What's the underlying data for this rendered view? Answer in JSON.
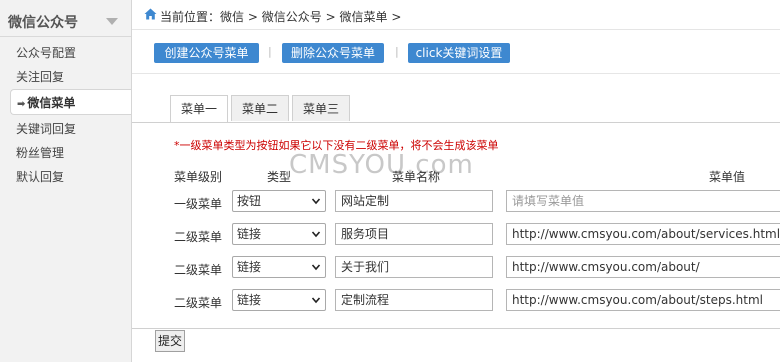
{
  "sidebar": {
    "title": "微信公众号",
    "items": [
      {
        "label": "公众号配置"
      },
      {
        "label": "关注回复"
      },
      {
        "label": "微信菜单"
      },
      {
        "label": "关键词回复"
      },
      {
        "label": "粉丝管理"
      },
      {
        "label": "默认回复"
      }
    ]
  },
  "breadcrumb": {
    "prefix": "当前位置：",
    "items": [
      "微信",
      "微信公众号",
      "微信菜单"
    ],
    "separator": ">"
  },
  "toolbar": {
    "buttons": [
      {
        "label": "创建公众号菜单"
      },
      {
        "label": "删除公众号菜单"
      },
      {
        "label": "click关键词设置"
      }
    ],
    "separator": "|"
  },
  "tabs": [
    {
      "label": "菜单一",
      "active": true
    },
    {
      "label": "菜单二",
      "active": false
    },
    {
      "label": "菜单三",
      "active": false
    }
  ],
  "notice": "*一级菜单类型为按钮如果它以下没有二级菜单，将不会生成该菜单",
  "watermark": "CMSYOU.com",
  "table": {
    "headers": {
      "level": "菜单级别",
      "type": "类型",
      "name": "菜单名称",
      "value": "菜单值"
    },
    "rows": [
      {
        "level": "一级菜单",
        "type": "按钮",
        "name": "网站定制",
        "value": "",
        "value_placeholder": "请填写菜单值"
      },
      {
        "level": "二级菜单",
        "type": "链接",
        "name": "服务项目",
        "value": "http://www.cmsyou.com/about/services.html"
      },
      {
        "level": "二级菜单",
        "type": "链接",
        "name": "关于我们",
        "value": "http://www.cmsyou.com/about/"
      },
      {
        "level": "二级菜单",
        "type": "链接",
        "name": "定制流程",
        "value": "http://www.cmsyou.com/about/steps.html"
      }
    ]
  },
  "submit_label": "提交",
  "colors": {
    "accent": "#3e88d0",
    "notice": "#cc0000"
  }
}
